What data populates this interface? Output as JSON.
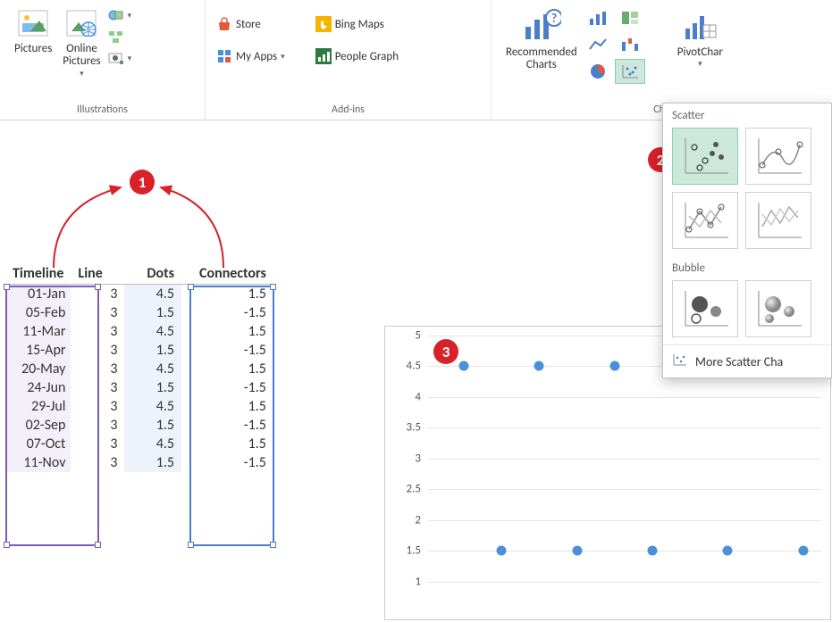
{
  "ribbon": {
    "illustrations": {
      "title": "Illustrations",
      "pictures": "Pictures",
      "online_pictures": "Online\nPictures"
    },
    "addins": {
      "title": "Add-ins",
      "store": "Store",
      "myapps": "My Apps",
      "bingmaps": "Bing Maps",
      "peoplegraph": "People Graph"
    },
    "charts": {
      "title": "Cha",
      "recommended": "Recommended\nCharts",
      "pivot": "PivotChar"
    },
    "scatter_panel": {
      "scatter_title": "Scatter",
      "bubble_title": "Bubble",
      "more": "More Scatter Cha"
    }
  },
  "annotations": {
    "a1": "1",
    "a2": "2",
    "a3": "3"
  },
  "table": {
    "headers": {
      "timeline": "Timeline",
      "line": "Line",
      "dots": "Dots",
      "connectors": "Connectors"
    },
    "rows": [
      {
        "timeline": "01-Jan",
        "line": "3",
        "dots": "4.5",
        "connectors": "1.5"
      },
      {
        "timeline": "05-Feb",
        "line": "3",
        "dots": "1.5",
        "connectors": "-1.5"
      },
      {
        "timeline": "11-Mar",
        "line": "3",
        "dots": "4.5",
        "connectors": "1.5"
      },
      {
        "timeline": "15-Apr",
        "line": "3",
        "dots": "1.5",
        "connectors": "-1.5"
      },
      {
        "timeline": "20-May",
        "line": "3",
        "dots": "4.5",
        "connectors": "1.5"
      },
      {
        "timeline": "24-Jun",
        "line": "3",
        "dots": "1.5",
        "connectors": "-1.5"
      },
      {
        "timeline": "29-Jul",
        "line": "3",
        "dots": "4.5",
        "connectors": "1.5"
      },
      {
        "timeline": "02-Sep",
        "line": "3",
        "dots": "1.5",
        "connectors": "-1.5"
      },
      {
        "timeline": "07-Oct",
        "line": "3",
        "dots": "4.5",
        "connectors": "1.5"
      },
      {
        "timeline": "11-Nov",
        "line": "3",
        "dots": "1.5",
        "connectors": "-1.5"
      }
    ]
  },
  "chart_data": {
    "type": "scatter",
    "title": "",
    "xlabel": "",
    "ylabel": "",
    "ylim": [
      0.5,
      5
    ],
    "yticks": [
      5,
      4.5,
      4,
      3.5,
      3,
      2.5,
      2,
      1.5,
      1
    ],
    "x": [
      1,
      2,
      3,
      4,
      5,
      6,
      7,
      8,
      9,
      10
    ],
    "values": [
      4.5,
      1.5,
      4.5,
      1.5,
      4.5,
      1.5,
      4.5,
      1.5,
      4.5,
      1.5
    ]
  }
}
